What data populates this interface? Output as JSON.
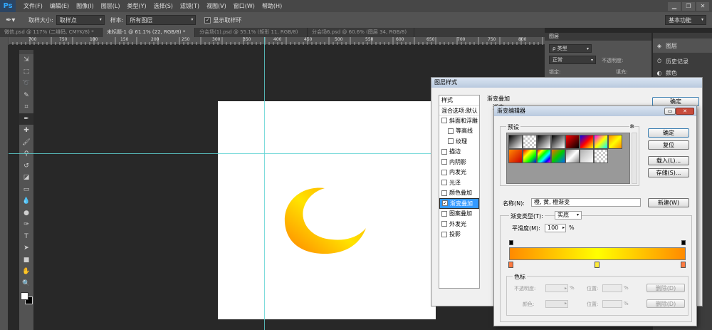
{
  "menubar": {
    "logo": "Ps",
    "items": [
      "文件(F)",
      "编辑(E)",
      "图像(I)",
      "图层(L)",
      "类型(Y)",
      "选择(S)",
      "滤镜(T)",
      "视图(V)",
      "窗口(W)",
      "帮助(H)"
    ]
  },
  "options": {
    "sample_size_label": "取样大小:",
    "sample_size_value": "取样点",
    "sample_label": "样本:",
    "sample_value": "所有图层",
    "show_ring_label": "显示取样环",
    "workspace": "基本功能"
  },
  "tabs": [
    "微信.psd @ 117% (二维码, CMYK/8) *",
    "未标题-1 @ 61.1% (22, RGB/8) *",
    "分会场(1).psd @ 55.1% (矩形 11, RGB/8)",
    "分会场6.psd @ 60.6% (图层 34, RGB/8)"
  ],
  "ruler_marks": [
    "700",
    "750",
    "100",
    "150",
    "200",
    "250",
    "300",
    "350",
    "400",
    "450",
    "500",
    "550",
    "600",
    "650",
    "700",
    "750",
    "800",
    "850"
  ],
  "tools": [
    "move",
    "marquee",
    "lasso",
    "quick-select",
    "crop",
    "eyedropper",
    "healing",
    "brush",
    "clone",
    "history-brush",
    "eraser",
    "gradient",
    "blur",
    "dodge",
    "pen",
    "type",
    "path-select",
    "rectangle",
    "hand",
    "zoom"
  ],
  "layers_panel": {
    "title": "图层",
    "kind_label": "ρ 类型",
    "blend_mode": "正常",
    "opacity_label": "不透明度:",
    "lock_label": "锁定:",
    "fill_label": "填充:"
  },
  "side_dock": {
    "items": [
      {
        "label": "图层",
        "icon": "layers-icon"
      },
      {
        "label": "历史记录",
        "icon": "history-icon"
      },
      {
        "label": "颜色",
        "icon": "color-icon"
      }
    ]
  },
  "layer_style": {
    "title": "图层样式",
    "styles_header": "样式",
    "blend_options": "混合选项:默认",
    "items": [
      {
        "label": "斜面和浮雕",
        "checked": false
      },
      {
        "label": "等高线",
        "checked": false,
        "indent": true
      },
      {
        "label": "纹理",
        "checked": false,
        "indent": true
      },
      {
        "label": "描边",
        "checked": false
      },
      {
        "label": "内阴影",
        "checked": false
      },
      {
        "label": "内发光",
        "checked": false
      },
      {
        "label": "光泽",
        "checked": false
      },
      {
        "label": "颜色叠加",
        "checked": false
      },
      {
        "label": "渐变叠加",
        "checked": true,
        "selected": true
      },
      {
        "label": "图案叠加",
        "checked": false
      },
      {
        "label": "外发光",
        "checked": false
      },
      {
        "label": "投影",
        "checked": false
      }
    ],
    "section_title": "渐变叠加",
    "section_sub": "渐变",
    "ok": "确定"
  },
  "gradient_editor": {
    "title": "渐变编辑器",
    "presets_label": "预设",
    "ok": "确定",
    "reset": "复位",
    "load": "载入(L)...",
    "save": "存储(S)...",
    "name_label": "名称(N):",
    "name_value": "橙, 黄, 橙渐变",
    "new": "新建(W)",
    "type_label": "渐变类型(T):",
    "type_value": "实底",
    "smooth_label": "平滑度(M):",
    "smooth_value": "100",
    "smooth_unit": "%",
    "stops_label": "色标",
    "opacity_label": "不透明度:",
    "color_label": "颜色:",
    "location_label": "位置:",
    "delete_label": "删除(D)",
    "pct": "%",
    "gradient_colors": [
      "#ff8a00",
      "#ffff00",
      "#ff8a00"
    ]
  },
  "colors": {
    "fg": "#ffffff",
    "bg": "#000000",
    "guide": "#5fd3d3",
    "ring_outer": "#ff8a00",
    "ring_inner": "#ffee00"
  }
}
